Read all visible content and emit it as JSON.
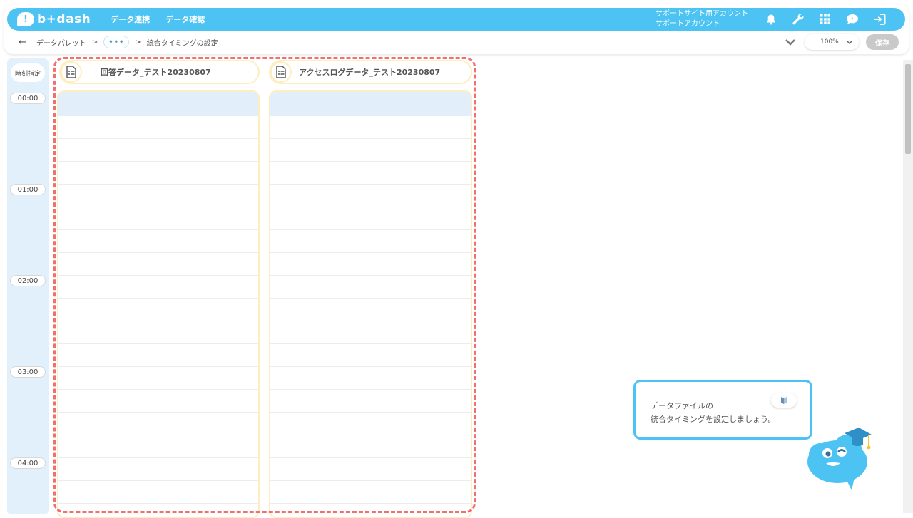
{
  "brand": {
    "name": "b+dash",
    "bubble_glyph": "!"
  },
  "nav": {
    "items": [
      "データ連携",
      "データ確認"
    ]
  },
  "account": {
    "line1": "サポートサイト用アカウント",
    "line2": "サポートアカウント"
  },
  "icons": {
    "bell": "bell-icon",
    "wrench": "wrench-icon",
    "grid": "grid-icon",
    "help": "help-icon",
    "logout": "logout-icon"
  },
  "breadcrumb": {
    "back": "←",
    "item1": "データパレット",
    "sep": ">",
    "more": "•••",
    "current": "統合タイミングの設定"
  },
  "controls": {
    "zoom": "100%",
    "save": "保存"
  },
  "timeline": {
    "header": "時刻指定",
    "labels": [
      "00:00",
      "01:00",
      "02:00",
      "03:00",
      "04:00"
    ]
  },
  "files": [
    {
      "name": "回答データ_テスト20230807"
    },
    {
      "name": "アクセスログデータ_テスト20230807"
    }
  ],
  "tip": {
    "line1": "データファイルの",
    "line2": "統合タイミングを設定しましょう。"
  },
  "colors": {
    "accent": "#4cc3f2",
    "dashed_frame": "#f07070",
    "lane_border": "#fdeec0",
    "lane_head": "#e2eef9"
  }
}
